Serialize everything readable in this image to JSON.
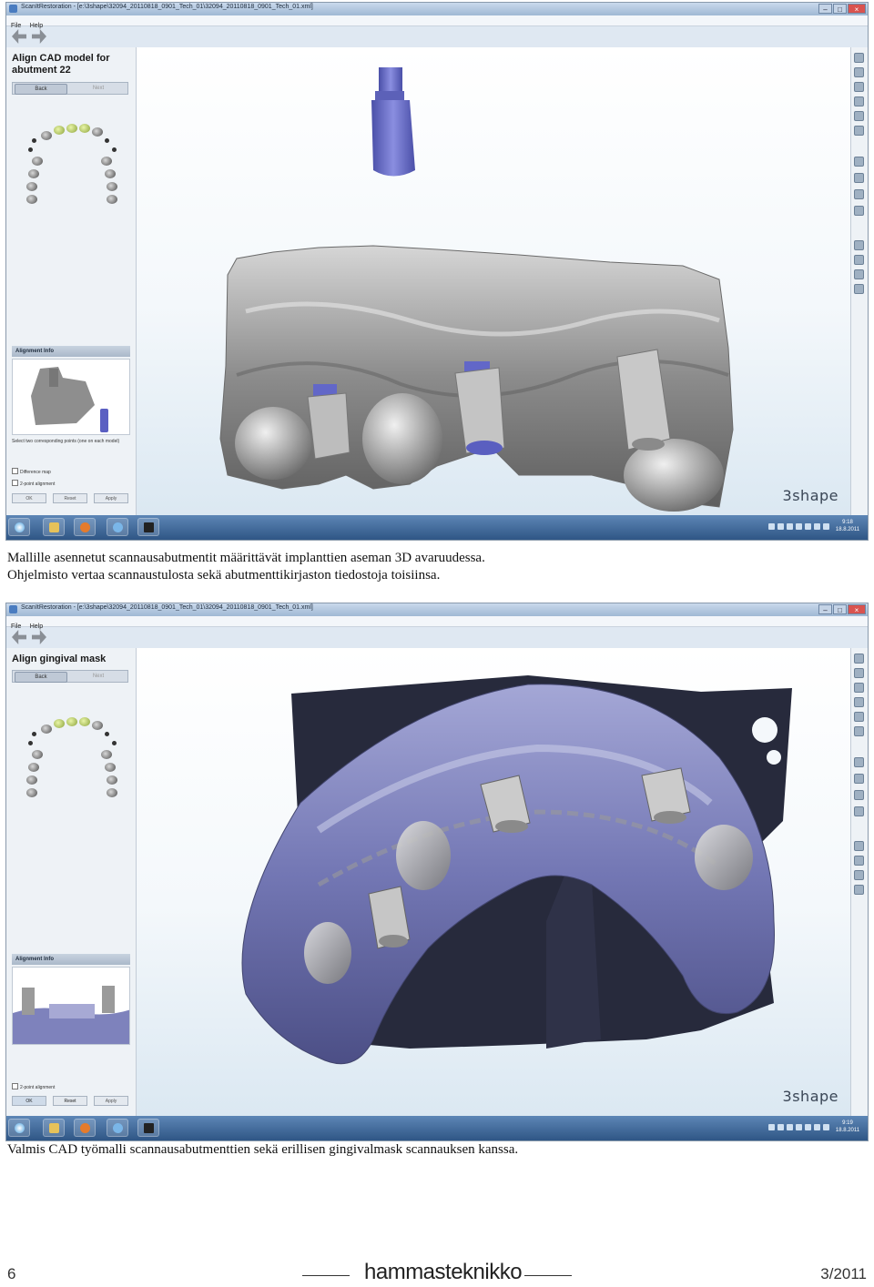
{
  "window1": {
    "title": "ScanItRestoration - [e:\\3shape\\32094_20110818_0901_Tech_01\\32094_20110818_0901_Tech_01.xml]",
    "menu": [
      "File",
      "Help"
    ],
    "step_title": "Align CAD model for abutment 22",
    "back_label": "Back",
    "next_label": "Next",
    "panel_header": "Alignment Info",
    "instruction": "Select two corresponding points (one on each model)",
    "checkboxes": [
      "Difference map",
      "2-point alignment"
    ],
    "buttons": [
      "OK",
      "Reset",
      "Apply"
    ],
    "clock_time": "9:18",
    "clock_date": "18.8.2011",
    "brand": "3shape"
  },
  "window2": {
    "title": "ScanItRestoration - [e:\\3shape\\32094_20110818_0901_Tech_01\\32094_20110818_0901_Tech_01.xml]",
    "menu": [
      "File",
      "Help"
    ],
    "step_title": "Align gingival mask",
    "back_label": "Back",
    "next_label": "Next",
    "panel_header": "Alignment Info",
    "checkboxes": [
      "2-point alignment"
    ],
    "buttons": [
      "OK",
      "Reset",
      "Apply"
    ],
    "clock_time": "9:19",
    "clock_date": "18.8.2011",
    "brand": "3shape"
  },
  "captions": {
    "line1": "Mallille asennetut scannausabutmentit määrittävät implanttien aseman 3D avaruudessa.",
    "line2": "Ohjelmisto vertaa scannaustulosta sekä abutmenttikirjaston tiedostoja toisiinsa.",
    "line3": "Valmis CAD työmalli  scannausabutmenttien sekä erillisen gingivalmask scannauksen kanssa."
  },
  "footer": {
    "page_number": "6",
    "magazine": "hammasteknikko",
    "issue": "3/2011"
  },
  "colors": {
    "abutment_blue": "#6b6fc4",
    "gingiva_purple": "#7b7eb8",
    "model_gray": "#9a9a9a",
    "taskbar": "#2f5685"
  }
}
